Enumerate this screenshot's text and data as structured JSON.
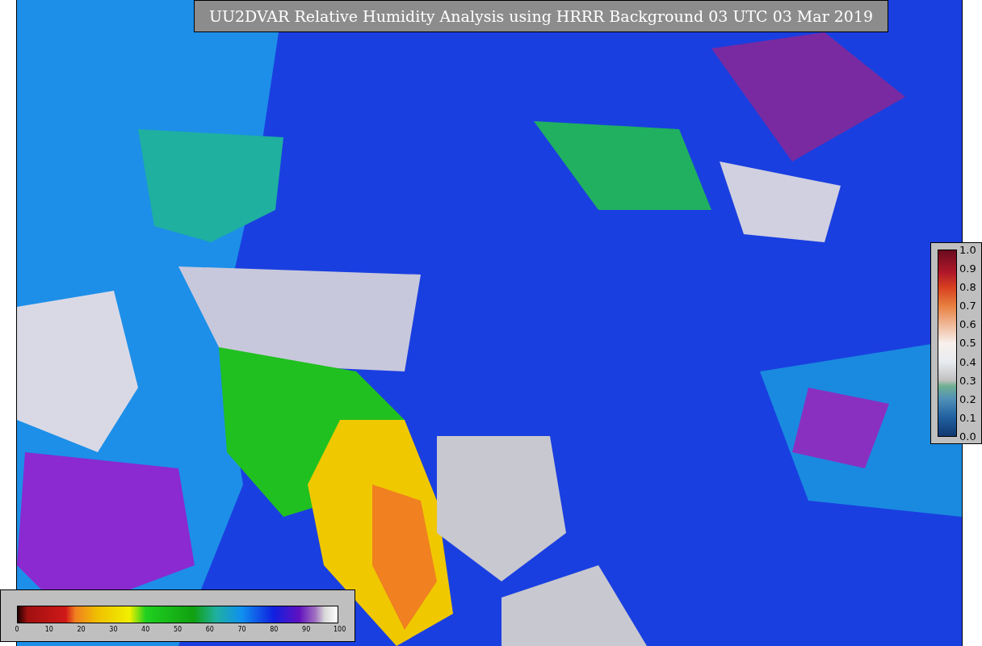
{
  "title": "UU2DVAR Relative Humidity Analysis using HRRR Background 03 UTC 03 Mar 2019",
  "ratio_legend": {
    "ticks": [
      "1.0",
      "0.9",
      "0.8",
      "0.7",
      "0.6",
      "0.5",
      "0.4",
      "0.3",
      "0.2",
      "0.1",
      "0.0"
    ]
  },
  "humidity_legend": {
    "ticks": [
      "0",
      "10",
      "20",
      "30",
      "40",
      "50",
      "60",
      "70",
      "80",
      "90",
      "100"
    ]
  }
}
